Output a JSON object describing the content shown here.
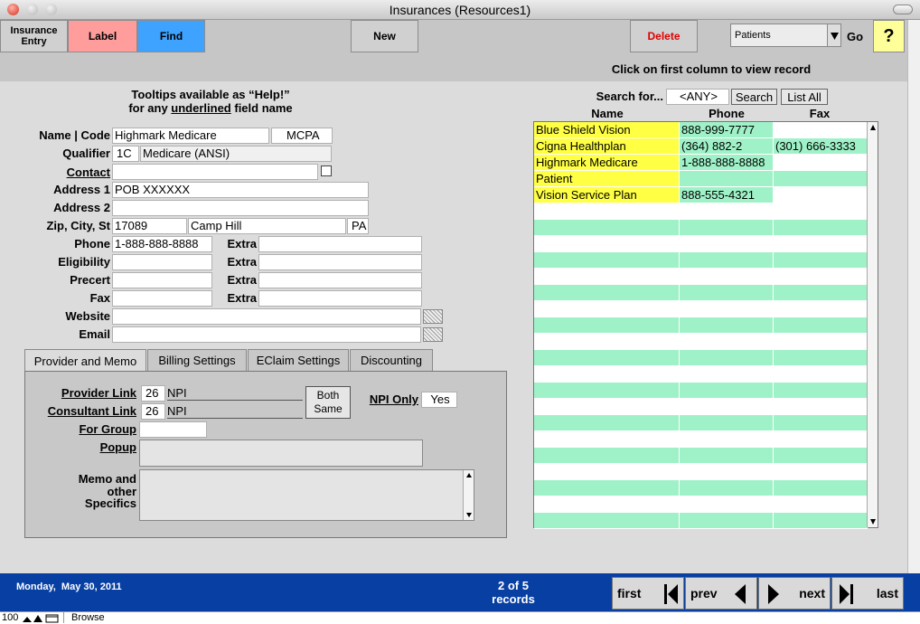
{
  "window": {
    "title": "Insurances (Resources1)"
  },
  "toolbar": {
    "insurance_entry": "Insurance Entry",
    "label": "Label",
    "find": "Find",
    "new": "New",
    "delete": "Delete",
    "dropdown_value": "Patients",
    "go": "Go",
    "help": "?",
    "colors": {
      "label_bg": "#ff9c9c",
      "find_bg": "#3ea2ff",
      "delete_text": "#e00000",
      "help_bg": "#ffff99"
    }
  },
  "banner": {
    "text": "Click on first column to view record"
  },
  "tooltip": {
    "line1": "Tooltips available as “Help!”",
    "line2_pre": "for any ",
    "line2_u": "underlined",
    "line2_post": " field name"
  },
  "form": {
    "name_code_label": "Name | Code",
    "name": "Highmark Medicare",
    "code": "MCPA",
    "qualifier_label": "Qualifier",
    "qualifier_code": "1C",
    "qualifier_desc": "Medicare (ANSI)",
    "contact_label": "Contact",
    "contact": "",
    "address1_label": "Address 1",
    "address1": "POB XXXXXX",
    "address2_label": "Address 2",
    "address2": "",
    "zcs_label": "Zip, City, St",
    "zip": "17089",
    "city": "Camp Hill",
    "state": "PA",
    "phone_label": "Phone",
    "phone": "1-888-888-8888",
    "eligibility_label": "Eligibility",
    "precert_label": "Precert",
    "fax_label": "Fax",
    "extra_label": "Extra",
    "website_label": "Website",
    "email_label": "Email"
  },
  "tabs": [
    "Provider and Memo",
    "Billing Settings",
    "EClaim Settings",
    "Discounting"
  ],
  "provider": {
    "provider_link_label": "Provider Link",
    "provider_link_num": "26",
    "provider_link_type": "NPI",
    "consultant_link_label": "Consultant Link",
    "consultant_link_num": "26",
    "consultant_link_type": "NPI",
    "both_same": "Both Same",
    "npi_only_label": "NPI Only",
    "npi_only_value": "Yes",
    "for_group_label": "For Group",
    "popup_label": "Popup",
    "memo_label": "Memo and other Specifics"
  },
  "search": {
    "label": "Search for...",
    "value": "<ANY>",
    "search_btn": "Search",
    "list_all_btn": "List All"
  },
  "list": {
    "headers": [
      "Name",
      "Phone",
      "Fax"
    ],
    "rows": [
      [
        "Blue Shield Vision",
        "888-999-7777",
        ""
      ],
      [
        "Cigna Healthplan",
        "(364) 882-2",
        "(301) 666-3333"
      ],
      [
        "Highmark Medicare",
        "1-888-888-8888",
        ""
      ],
      [
        "Patient",
        "",
        ""
      ],
      [
        "Vision Service Plan",
        "888-555-4321",
        ""
      ]
    ],
    "empty_rows": 20
  },
  "footer": {
    "date": "Monday,  May 30, 2011",
    "record_pos": "2 of 5",
    "records_word": "records",
    "first": "first",
    "prev": "prev",
    "next": "next",
    "last": "last"
  },
  "status": {
    "zoom": "100",
    "mode": "Browse"
  }
}
